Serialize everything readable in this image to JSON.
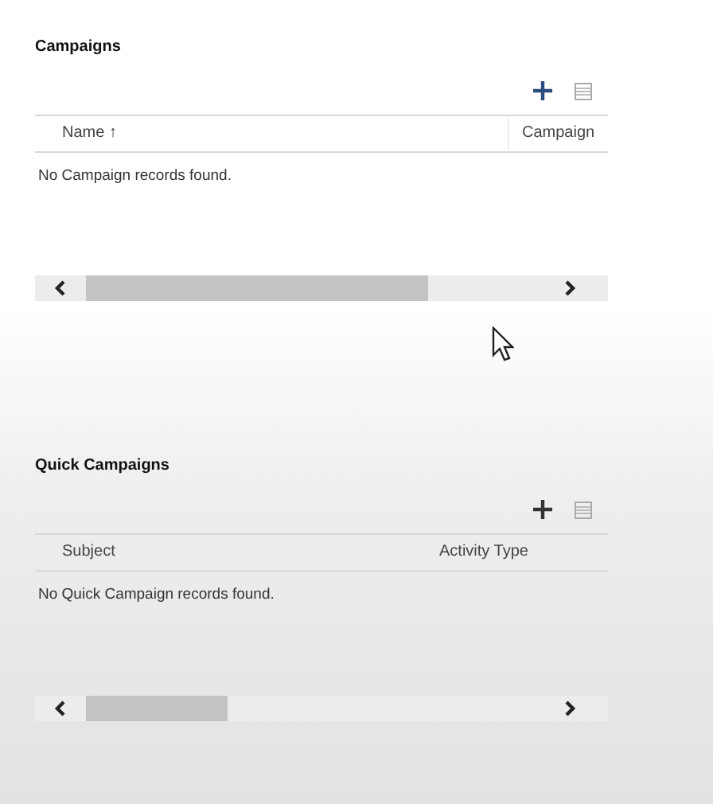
{
  "sections": [
    {
      "title": "Campaigns",
      "columns": [
        "Name ↑",
        "Campaign"
      ],
      "empty_message": "No Campaign records found."
    },
    {
      "title": "Quick Campaigns",
      "columns": [
        "Subject",
        "Activity Type"
      ],
      "empty_message": "No Quick Campaign records found."
    }
  ]
}
